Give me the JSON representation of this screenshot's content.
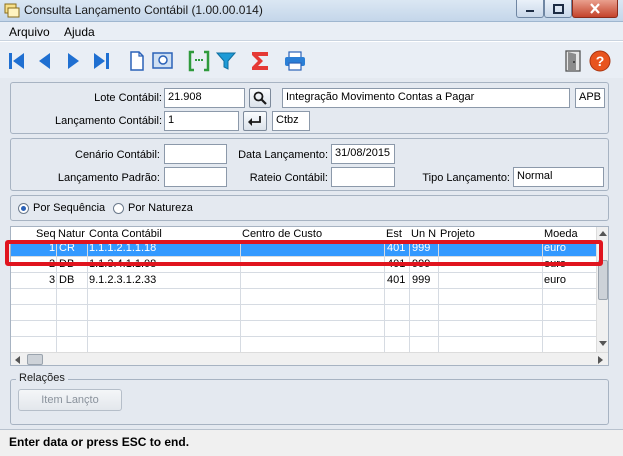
{
  "window": {
    "title": "Consulta Lançamento Contábil (1.00.00.014)"
  },
  "menu": {
    "items": [
      "Arquivo",
      "Ajuda"
    ]
  },
  "toolbar": {
    "icons": [
      "first-record-icon",
      "previous-record-icon",
      "next-record-icon",
      "last-record-icon",
      "new-document-icon",
      "preview-icon",
      "code-bracket-icon",
      "filter-icon",
      "sigma-icon",
      "print-icon",
      "exit-door-icon",
      "help-icon"
    ]
  },
  "form": {
    "lote_label": "Lote Contábil:",
    "lote_value": "21.908",
    "lote_desc": "Integração Movimento Contas a Pagar",
    "lote_code": "APB",
    "lancamento_label": "Lançamento Contábil:",
    "lancamento_value": "1",
    "lancamento_code": "Ctbz",
    "cenario_label": "Cenário Contábil:",
    "cenario_value": "",
    "data_label": "Data Lançamento:",
    "data_value": "31/08/2015",
    "padrao_label": "Lançamento Padrão:",
    "padrao_value": "",
    "rateio_label": "Rateio Contábil:",
    "rateio_value": "",
    "tipo_label": "Tipo Lançamento:",
    "tipo_value": "Normal"
  },
  "sort": {
    "options": [
      "Por Sequência",
      "Por Natureza"
    ],
    "selected": "Por Sequência"
  },
  "grid": {
    "columns": [
      "Seq",
      "Natur",
      "Conta Contábil",
      "Centro de Custo",
      "Est",
      "Un N",
      "Projeto",
      "Moeda"
    ],
    "rows": [
      {
        "seq": "1",
        "natur": "CR",
        "conta": "1.1.1.2.1.1.18",
        "centro": "",
        "est": "401",
        "un": "999",
        "projeto": "",
        "moeda": "euro"
      },
      {
        "seq": "2",
        "natur": "DB",
        "conta": "1.1.3.4.1.1.08",
        "centro": "",
        "est": "401",
        "un": "999",
        "projeto": "",
        "moeda": "euro"
      },
      {
        "seq": "3",
        "natur": "DB",
        "conta": "9.1.2.3.1.2.33",
        "centro": "",
        "est": "401",
        "un": "999",
        "projeto": "",
        "moeda": "euro"
      }
    ],
    "selected_row": 0
  },
  "relations": {
    "legend": "Relações",
    "button": "Item Lançto"
  },
  "status": {
    "text": "Enter data or press ESC to end."
  },
  "colors": {
    "selection": "#3399ff",
    "highlight": "#e0141e",
    "accent": "#1f6fd1"
  }
}
